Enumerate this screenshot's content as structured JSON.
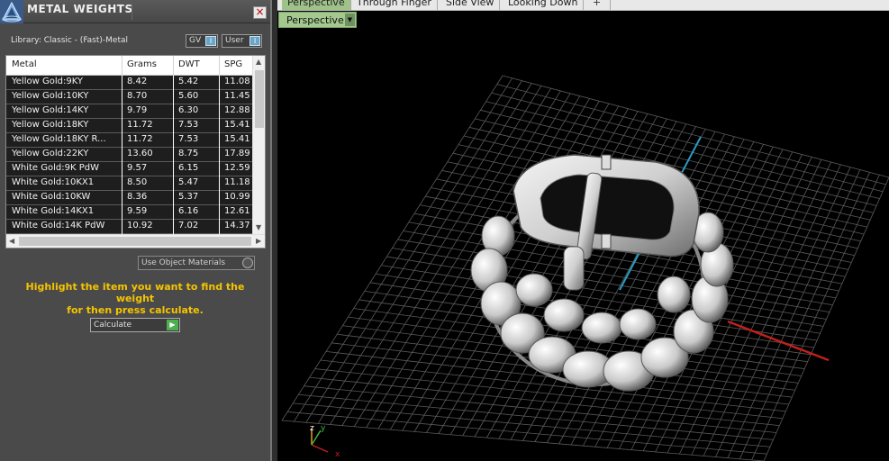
{
  "panel": {
    "title": "METAL WEIGHTS",
    "close_glyph": "×",
    "library_label": "Library: Classic - (Fast)-Metal",
    "gv_label": "GV",
    "user_label": "User",
    "toggle_glyph": "I",
    "table": {
      "columns": [
        "Metal",
        "Grams",
        "DWT",
        "SPG"
      ],
      "rows": [
        [
          "Yellow Gold:9KY",
          "8.42",
          "5.42",
          "11.08"
        ],
        [
          "Yellow Gold:10KY",
          "8.70",
          "5.60",
          "11.45"
        ],
        [
          "Yellow Gold:14KY",
          "9.79",
          "6.30",
          "12.88"
        ],
        [
          "Yellow Gold:18KY",
          "11.72",
          "7.53",
          "15.41"
        ],
        [
          "Yellow Gold:18KY R...",
          "11.72",
          "7.53",
          "15.41"
        ],
        [
          "Yellow Gold:22KY",
          "13.60",
          "8.75",
          "17.89"
        ],
        [
          "White Gold:9K PdW",
          "9.57",
          "6.15",
          "12.59"
        ],
        [
          "White Gold:10KX1",
          "8.50",
          "5.47",
          "11.18"
        ],
        [
          "White Gold:10KW",
          "8.36",
          "5.37",
          "10.99"
        ],
        [
          "White Gold:14KX1",
          "9.59",
          "6.16",
          "12.61"
        ],
        [
          "White Gold:14K PdW",
          "10.92",
          "7.02",
          "14.37"
        ]
      ]
    },
    "use_object_materials": "Use Object Materials",
    "hint_line1": "Highlight the item you want to find the weight",
    "hint_line2": "for then press calculate.",
    "calculate_label": "Calculate",
    "calculate_glyph": "▶",
    "scroll_up": "▲",
    "scroll_down": "▼",
    "scroll_left": "◀",
    "scroll_right": "▶"
  },
  "view_tabs": [
    "Perspective",
    "Through Finger",
    "Side View",
    "Looking Down"
  ],
  "add_tab_glyph": "+",
  "viewport": {
    "label": "Perspective",
    "dropdown_glyph": "▼",
    "axis_z": "z",
    "axis_y": "y",
    "axis_x": "x"
  },
  "colors": {
    "hint": "#f5c400",
    "active_tab": "#9ec28a",
    "axis_red": "#c0201a",
    "axis_blue": "#2a9bc0",
    "axis_green": "#3fb43f"
  }
}
